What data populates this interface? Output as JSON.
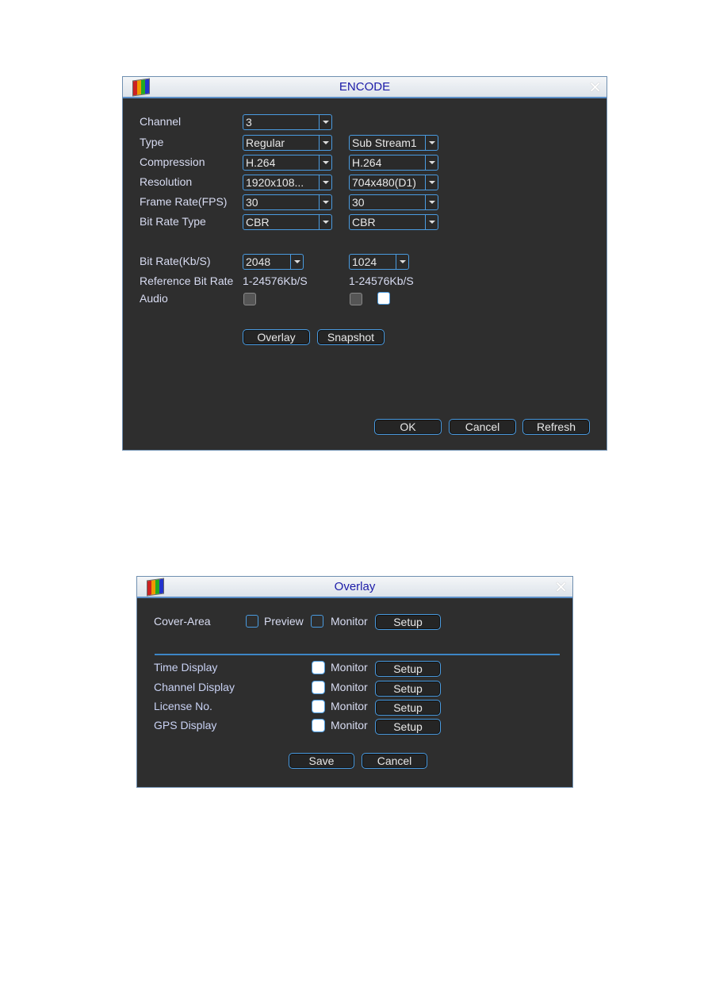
{
  "encode": {
    "title": "ENCODE",
    "labels": {
      "channel": "Channel",
      "type": "Type",
      "compression": "Compression",
      "resolution": "Resolution",
      "frame_rate": "Frame Rate(FPS)",
      "bit_rate_type": "Bit Rate Type",
      "bit_rate": "Bit Rate(Kb/S)",
      "reference_bit_rate": "Reference Bit Rate",
      "audio": "Audio"
    },
    "channel": "3",
    "main": {
      "type": "Regular",
      "compression": "H.264",
      "resolution": "1920x108...",
      "frame_rate": "30",
      "bit_rate_type": "CBR",
      "bit_rate": "2048",
      "reference_bit_rate": "1-24576Kb/S",
      "audio_checked": false
    },
    "sub": {
      "type": "Sub Stream1",
      "compression": "H.264",
      "resolution": "704x480(D1)",
      "frame_rate": "30",
      "bit_rate_type": "CBR",
      "bit_rate": "1024",
      "reference_bit_rate": "1-24576Kb/S",
      "audio_checked": false,
      "extra_checked": false
    },
    "buttons": {
      "overlay": "Overlay",
      "snapshot": "Snapshot",
      "ok": "OK",
      "cancel": "Cancel",
      "refresh": "Refresh"
    }
  },
  "overlay": {
    "title": "Overlay",
    "cover_area": {
      "label": "Cover-Area",
      "preview": "Preview",
      "monitor": "Monitor",
      "setup": "Setup"
    },
    "rows": [
      {
        "label": "Time Display",
        "monitor": "Monitor",
        "setup": "Setup"
      },
      {
        "label": "Channel Display",
        "monitor": "Monitor",
        "setup": "Setup"
      },
      {
        "label": "License No.",
        "monitor": "Monitor",
        "setup": "Setup"
      },
      {
        "label": "GPS Display",
        "monitor": "Monitor",
        "setup": "Setup"
      }
    ],
    "buttons": {
      "save": "Save",
      "cancel": "Cancel"
    }
  },
  "colors": {
    "accent": "#4a9be0",
    "title_text": "#1b1ba8",
    "panel": "#2e2e2e"
  }
}
